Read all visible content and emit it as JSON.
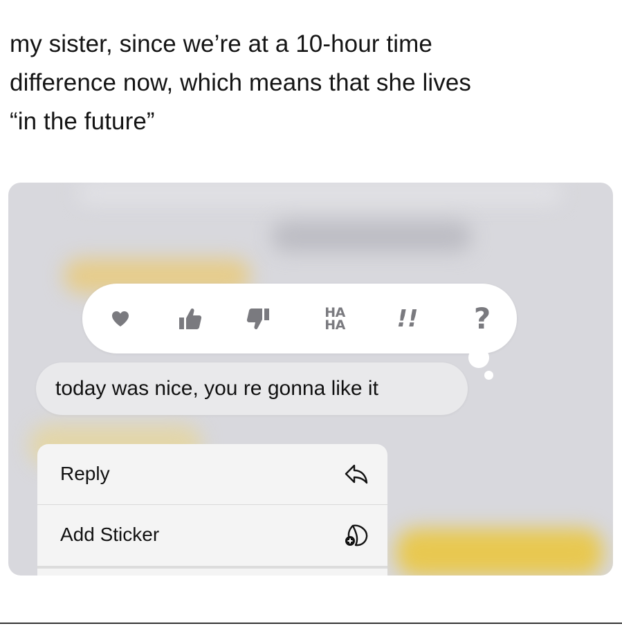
{
  "caption": {
    "line1": "my sister, since we’re at a 10-hour time",
    "line2": "difference now, which means that she lives",
    "line3": "“in the future”"
  },
  "tapbacks": {
    "heart": "heart-icon",
    "thumbs_up": "thumbs-up-icon",
    "thumbs_down": "thumbs-down-icon",
    "haha_line1": "HA",
    "haha_line2": "HA",
    "exclamation": "!!",
    "question": "?"
  },
  "message": {
    "text": "today was nice, you re gonna like it"
  },
  "context_menu": {
    "items": [
      {
        "label": "Reply",
        "icon": "reply-icon"
      },
      {
        "label": "Add Sticker",
        "icon": "add-sticker-icon"
      }
    ]
  }
}
